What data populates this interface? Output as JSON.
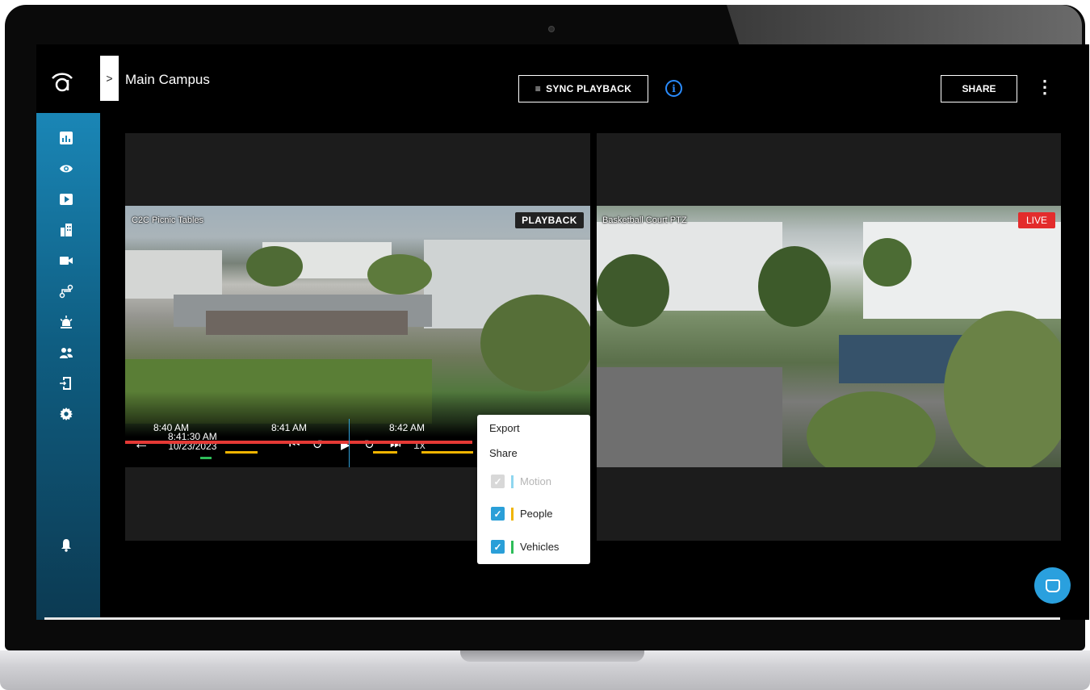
{
  "header": {
    "site_title": "Main Campus",
    "sync_label": "SYNC PLAYBACK",
    "share_label": "SHARE"
  },
  "sidebar": {
    "items": [
      {
        "name": "dashboard",
        "icon": "bar-chart-icon"
      },
      {
        "name": "live-view",
        "icon": "eye-icon",
        "active": true
      },
      {
        "name": "playback",
        "icon": "play-icon"
      },
      {
        "name": "sites",
        "icon": "buildings-icon"
      },
      {
        "name": "cameras",
        "icon": "video-camera-icon"
      },
      {
        "name": "workflows",
        "icon": "routing-icon"
      },
      {
        "name": "alerts",
        "icon": "siren-icon"
      },
      {
        "name": "people",
        "icon": "people-icon"
      },
      {
        "name": "access",
        "icon": "door-icon"
      },
      {
        "name": "settings",
        "icon": "gear-icon"
      }
    ],
    "notifications_icon": "bell-icon"
  },
  "left_feed": {
    "camera_name": "C2C Picnic Tables",
    "mode_badge": "PLAYBACK",
    "time": "8:41:30 AM",
    "date": "10/23/2023",
    "speed": "1x",
    "timeline_ticks": [
      "8:40 AM",
      "8:41 AM",
      "8:42 AM"
    ]
  },
  "right_feed": {
    "camera_name": "Basketball Court PTZ",
    "mode_badge": "LIVE"
  },
  "menu": {
    "export_label": "Export",
    "share_label": "Share",
    "filters": [
      {
        "label": "Motion",
        "checked": true,
        "disabled": true,
        "color": "#2fb2e0"
      },
      {
        "label": "People",
        "checked": true,
        "disabled": false,
        "color": "#f0b400"
      },
      {
        "label": "Vehicles",
        "checked": true,
        "disabled": false,
        "color": "#2ebd59"
      }
    ]
  },
  "colors": {
    "accent": "#2a9fd8",
    "live": "#e32c2c",
    "timeline": "#e53935"
  }
}
